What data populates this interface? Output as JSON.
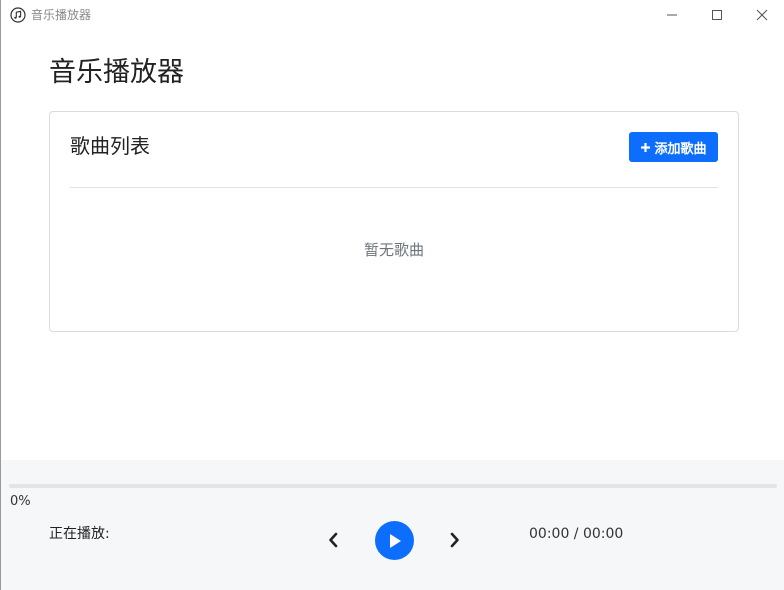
{
  "window": {
    "title": "音乐播放器",
    "app_icon": "music-note-icon",
    "controls": [
      "minimize-icon",
      "maximize-icon",
      "close-icon"
    ]
  },
  "page": {
    "title": "音乐播放器"
  },
  "song_list": {
    "title": "歌曲列表",
    "add_button_label": "添加歌曲",
    "add_button_icon": "plus-icon",
    "empty_message": "暂无歌曲",
    "songs": []
  },
  "player": {
    "progress_percent": 0,
    "progress_label": "0%",
    "now_playing_label": "正在播放:",
    "now_playing_title": "",
    "time_display": "00:00 / 00:00",
    "prev_icon": "chevron-left-icon",
    "play_icon": "play-icon",
    "next_icon": "chevron-right-icon"
  },
  "colors": {
    "accent": "#0d6efd",
    "player_background": "#f6f7f9",
    "muted_text": "#6c757d"
  }
}
